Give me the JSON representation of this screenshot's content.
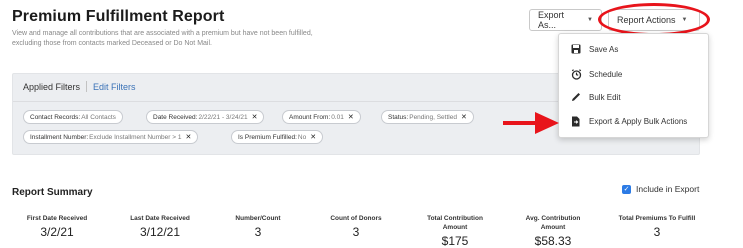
{
  "header": {
    "title": "Premium Fulfillment Report",
    "description": "View and manage all contributions that are associated with a premium but have not been fulfilled, excluding those from contacts marked Deceased or Do Not Mail."
  },
  "toolbar": {
    "export_label": "Export As...",
    "report_actions_label": "Report Actions"
  },
  "filters": {
    "applied_label": "Applied Filters",
    "edit_label": "Edit Filters",
    "chips": [
      {
        "key": "Contact Records:",
        "value": "All Contacts",
        "removable": false
      },
      {
        "key": "Date Received:",
        "value": "2/22/21 - 3/24/21",
        "removable": true
      },
      {
        "key": "Amount From:",
        "value": "0.01",
        "removable": true
      },
      {
        "key": "Status:",
        "value": "Pending, Settled",
        "removable": true
      },
      {
        "key": "Installment Number:",
        "value": "Exclude Installment Number > 1",
        "removable": true
      },
      {
        "key": "Is Premium Fulfilled:",
        "value": "No",
        "removable": true
      }
    ]
  },
  "menu": {
    "items": [
      {
        "label": "Save As",
        "icon": "save-icon"
      },
      {
        "label": "Schedule",
        "icon": "clock-icon"
      },
      {
        "label": "Bulk Edit",
        "icon": "pencil-icon"
      },
      {
        "label": "Export & Apply Bulk Actions",
        "icon": "file-export-icon"
      }
    ]
  },
  "summary": {
    "title": "Report Summary",
    "include_label": "Include in Export",
    "include_checked": true,
    "metrics": [
      {
        "label": "First Date Received",
        "value": "3/2/21"
      },
      {
        "label": "Last Date Received",
        "value": "3/12/21"
      },
      {
        "label": "Number/Count",
        "value": "3"
      },
      {
        "label": "Count of Donors",
        "value": "3"
      },
      {
        "label": "Total Contribution Amount",
        "value": "$175"
      },
      {
        "label": "Avg. Contribution Amount",
        "value": "$58.33"
      },
      {
        "label": "Total Premiums To Fulfill",
        "value": "3"
      }
    ]
  },
  "annotation_colors": {
    "highlight": "#e8141b",
    "link": "#3a72b7",
    "checkbox": "#2c7be5"
  }
}
